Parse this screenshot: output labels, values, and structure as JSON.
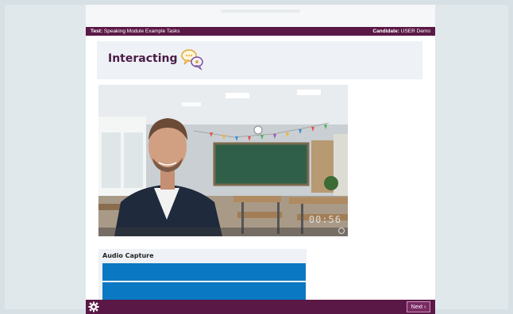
{
  "infobar": {
    "test_label": "Test:",
    "test_name": "Speaking Module Example Tasks",
    "candidate_label": "Candidate:",
    "candidate_name": "USER Demo"
  },
  "section": {
    "title": "Interacting",
    "icon": "speech-bubbles-icon"
  },
  "video": {
    "timer": "00:56",
    "fullscreen_icon": "fullscreen-icon"
  },
  "audio": {
    "title": "Audio Capture"
  },
  "footer": {
    "settings_icon": "gear-icon",
    "next_label": "Next",
    "next_icon": "chevron-right-icon"
  },
  "colors": {
    "brand": "#5a1846",
    "title": "#4a1c46",
    "audio_bar": "#0a78c2",
    "panel_bg": "#eef1f6"
  }
}
